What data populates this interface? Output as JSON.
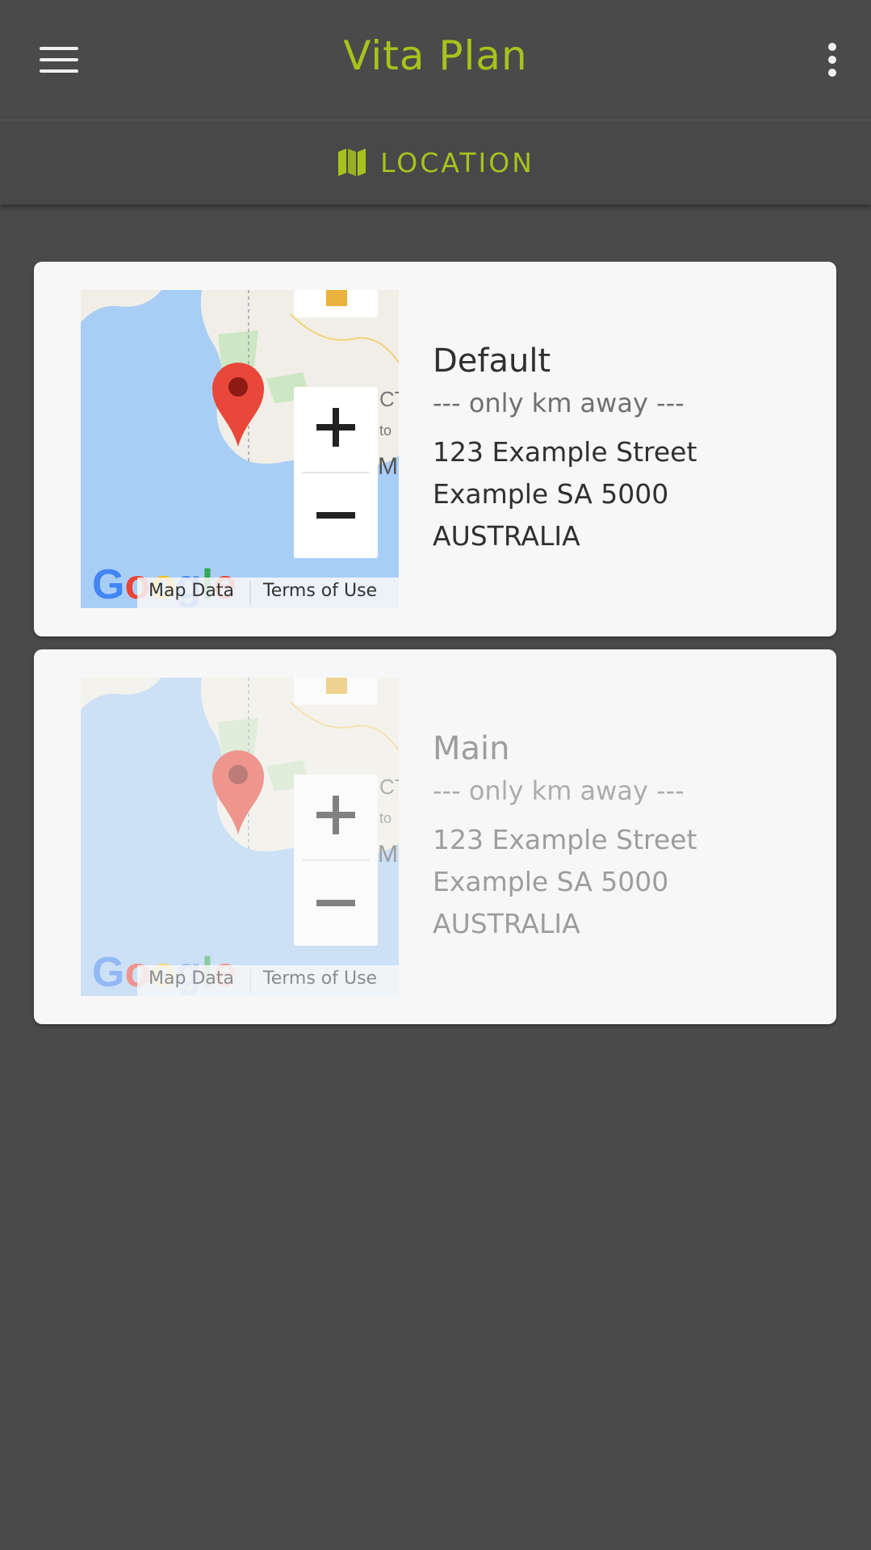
{
  "app": {
    "title": "Vita Plan",
    "accent_color": "#a6c31d",
    "background_color": "#4a4a4a"
  },
  "toolbar": {
    "menu_icon": "hamburger-menu-icon",
    "more_icon": "more-vertical-icon"
  },
  "tabs": [
    {
      "label": "LOCATION",
      "icon": "map-icon",
      "active": true
    }
  ],
  "locations": [
    {
      "name": "Default",
      "distance": "--- only km away ---",
      "address": [
        "123 Example Street",
        "Example SA 5000",
        "AUSTRALIA"
      ],
      "map": {
        "logo": "Google",
        "map_data_label": "Map Data",
        "terms_label": "Terms of Use",
        "marker_icon": "map-marker-icon"
      },
      "faded": false
    },
    {
      "name": "Main",
      "distance": "--- only km away ---",
      "address": [
        "123 Example Street",
        "Example SA 5000",
        "AUSTRALIA"
      ],
      "map": {
        "logo": "Google",
        "map_data_label": "Map Data",
        "terms_label": "Terms of Use",
        "marker_icon": "map-marker-icon"
      },
      "faded": true
    }
  ]
}
